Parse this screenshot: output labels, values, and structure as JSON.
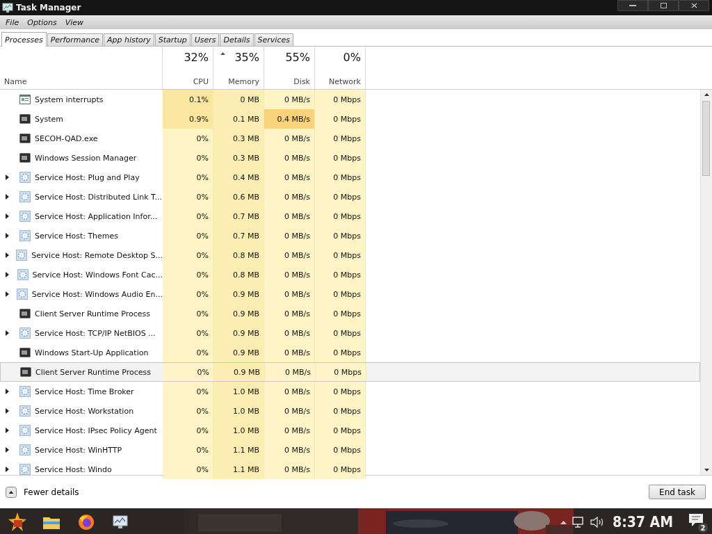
{
  "window": {
    "title": "Task Manager"
  },
  "menu": [
    "File",
    "Options",
    "View"
  ],
  "tabs": [
    {
      "label": "Processes",
      "selected": true
    },
    {
      "label": "Performance",
      "selected": false
    },
    {
      "label": "App history",
      "selected": false
    },
    {
      "label": "Startup",
      "selected": false
    },
    {
      "label": "Users",
      "selected": false
    },
    {
      "label": "Details",
      "selected": false
    },
    {
      "label": "Services",
      "selected": false
    }
  ],
  "columns": [
    {
      "label": "Name"
    },
    {
      "label": "CPU",
      "percent": "32%",
      "color": "#fff4c6",
      "sorted": false
    },
    {
      "label": "Memory",
      "percent": "35%",
      "color": "#fcedb2",
      "sorted": true
    },
    {
      "label": "Disk",
      "percent": "55%",
      "color": "#fff4c6",
      "sorted": false
    },
    {
      "label": "Network",
      "percent": "0%",
      "color": "#fff4c6",
      "sorted": false
    }
  ],
  "rows": [
    {
      "name": "System interrupts",
      "kind": "interrupts",
      "selected": false,
      "cells": [
        {
          "text": "0.1%",
          "color": "#fbe6a0"
        },
        {
          "text": "0 MB",
          "color": "#fcedb2"
        },
        {
          "text": "0 MB/s"
        },
        {
          "text": "0 Mbps"
        }
      ]
    },
    {
      "name": "System",
      "kind": "process",
      "selected": false,
      "cells": [
        {
          "text": "0.9%",
          "color": "#fbe6a0"
        },
        {
          "text": "0.1 MB"
        },
        {
          "text": "0.4 MB/s",
          "color": "#fad27a"
        },
        {
          "text": "0 Mbps"
        }
      ]
    },
    {
      "name": "SECOH-QAD.exe",
      "kind": "process",
      "selected": false,
      "cells": [
        {
          "text": "0%"
        },
        {
          "text": "0.3 MB"
        },
        {
          "text": "0 MB/s"
        },
        {
          "text": "0 Mbps"
        }
      ]
    },
    {
      "name": "Windows Session Manager",
      "kind": "process",
      "selected": false,
      "cells": [
        {
          "text": "0%"
        },
        {
          "text": "0.3 MB"
        },
        {
          "text": "0 MB/s"
        },
        {
          "text": "0 Mbps"
        }
      ]
    },
    {
      "name": "Service Host: Plug and Play",
      "kind": "service",
      "expanded": false,
      "selected": false,
      "cells": [
        {
          "text": "0%"
        },
        {
          "text": "0.4 MB"
        },
        {
          "text": "0 MB/s"
        },
        {
          "text": "0 Mbps"
        }
      ]
    },
    {
      "name": "Service Host: Distributed Link T...",
      "kind": "service",
      "expanded": false,
      "selected": false,
      "cells": [
        {
          "text": "0%"
        },
        {
          "text": "0.6 MB"
        },
        {
          "text": "0 MB/s"
        },
        {
          "text": "0 Mbps"
        }
      ]
    },
    {
      "name": "Service Host: Application Infor...",
      "kind": "service",
      "expanded": false,
      "selected": false,
      "cells": [
        {
          "text": "0%"
        },
        {
          "text": "0.7 MB"
        },
        {
          "text": "0 MB/s"
        },
        {
          "text": "0 Mbps"
        }
      ]
    },
    {
      "name": "Service Host: Themes",
      "kind": "service",
      "expanded": false,
      "selected": false,
      "cells": [
        {
          "text": "0%"
        },
        {
          "text": "0.7 MB"
        },
        {
          "text": "0 MB/s"
        },
        {
          "text": "0 Mbps"
        }
      ]
    },
    {
      "name": "Service Host: Remote Desktop S...",
      "kind": "service",
      "expanded": false,
      "selected": false,
      "cells": [
        {
          "text": "0%"
        },
        {
          "text": "0.8 MB"
        },
        {
          "text": "0 MB/s"
        },
        {
          "text": "0 Mbps"
        }
      ]
    },
    {
      "name": "Service Host: Windows Font Cac...",
      "kind": "service",
      "expanded": false,
      "selected": false,
      "cells": [
        {
          "text": "0%"
        },
        {
          "text": "0.8 MB"
        },
        {
          "text": "0 MB/s"
        },
        {
          "text": "0 Mbps"
        }
      ]
    },
    {
      "name": "Service Host: Windows Audio En...",
      "kind": "service",
      "expanded": false,
      "selected": false,
      "cells": [
        {
          "text": "0%"
        },
        {
          "text": "0.9 MB"
        },
        {
          "text": "0 MB/s"
        },
        {
          "text": "0 Mbps"
        }
      ]
    },
    {
      "name": "Client Server Runtime Process",
      "kind": "process",
      "selected": false,
      "cells": [
        {
          "text": "0%"
        },
        {
          "text": "0.9 MB"
        },
        {
          "text": "0 MB/s"
        },
        {
          "text": "0 Mbps"
        }
      ]
    },
    {
      "name": "Service Host: TCP/IP NetBIOS ...",
      "kind": "service",
      "expanded": false,
      "selected": false,
      "cells": [
        {
          "text": "0%"
        },
        {
          "text": "0.9 MB"
        },
        {
          "text": "0 MB/s"
        },
        {
          "text": "0 Mbps"
        }
      ]
    },
    {
      "name": "Windows Start-Up Application",
      "kind": "process",
      "selected": false,
      "cells": [
        {
          "text": "0%"
        },
        {
          "text": "0.9 MB"
        },
        {
          "text": "0 MB/s"
        },
        {
          "text": "0 Mbps"
        }
      ]
    },
    {
      "name": "Client Server Runtime Process",
      "kind": "process",
      "selected": true,
      "cells": [
        {
          "text": "0%"
        },
        {
          "text": "0.9 MB"
        },
        {
          "text": "0 MB/s"
        },
        {
          "text": "0 Mbps"
        }
      ]
    },
    {
      "name": "Service Host: Time Broker",
      "kind": "service",
      "expanded": false,
      "selected": false,
      "cells": [
        {
          "text": "0%"
        },
        {
          "text": "1.0 MB"
        },
        {
          "text": "0 MB/s"
        },
        {
          "text": "0 Mbps"
        }
      ]
    },
    {
      "name": "Service Host: Workstation",
      "kind": "service",
      "expanded": false,
      "selected": false,
      "cells": [
        {
          "text": "0%"
        },
        {
          "text": "1.0 MB"
        },
        {
          "text": "0 MB/s"
        },
        {
          "text": "0 Mbps"
        }
      ]
    },
    {
      "name": "Service Host: IPsec Policy Agent",
      "kind": "service",
      "expanded": false,
      "selected": false,
      "cells": [
        {
          "text": "0%"
        },
        {
          "text": "1.0 MB"
        },
        {
          "text": "0 MB/s"
        },
        {
          "text": "0 Mbps"
        }
      ]
    },
    {
      "name": "Service Host: WinHTTP",
      "kind": "service",
      "expanded": false,
      "selected": false,
      "cells": [
        {
          "text": "0%"
        },
        {
          "text": "1.1 MB"
        },
        {
          "text": "0 MB/s"
        },
        {
          "text": "0 Mbps"
        }
      ]
    },
    {
      "name": "Service Host: Windo",
      "kind": "service",
      "expanded": false,
      "selected": false,
      "cells": [
        {
          "text": "0%"
        },
        {
          "text": "1.1 MB"
        },
        {
          "text": "0 MB/s"
        },
        {
          "text": "0 Mbps"
        }
      ]
    }
  ],
  "footer": {
    "details_link": "Fewer details",
    "end_button": "End task"
  },
  "taskbar": {
    "clock": "8:37 AM",
    "notification_count": "2"
  }
}
